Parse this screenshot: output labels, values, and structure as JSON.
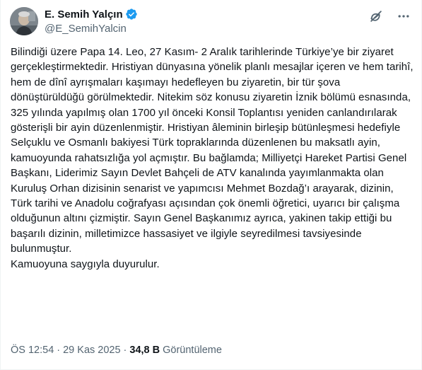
{
  "author": {
    "display_name": "E. Semih Yalçın",
    "handle": "@E_SemihYalcin",
    "verified_color": "#1d9bf0"
  },
  "header_actions": {
    "grok_icon": "grok-icon",
    "more_icon": "more-options-icon"
  },
  "tweet": {
    "text": "Bilindiği üzere Papa 14. Leo, 27 Kasım- 2 Aralık tarihlerinde Türkiye’ye bir ziyaret gerçekleştirmektedir. Hristiyan dünyasına yönelik planlı mesajlar içeren ve hem tarihî, hem de dînî ayrışmaları kaşımayı hedefleyen bu ziyaretin, bir tür şova dönüştürüldüğü görülmektedir. Nitekim söz konusu ziyaretin İznik bölümü esnasında, 325 yılında yapılmış olan 1700 yıl önceki Konsil Toplantısı yeniden canlandırılarak gösterişli bir ayin düzenlenmiştir. Hristiyan âleminin birleşip bütünleşmesi hedefiyle Selçuklu ve Osmanlı bakiyesi Türk topraklarında düzenlenen bu maksatlı ayin, kamuoyunda rahatsızlığa yol açmıştır. Bu bağlamda; Milliyetçi Hareket Partisi Genel Başkanı, Liderimiz Sayın Devlet Bahçeli de ATV kanalında yayımlanmakta olan Kuruluş Orhan dizisinin senarist ve yapımcısı Mehmet Bozdağ’ı arayarak, dizinin, Türk tarihi ve Anadolu coğrafyası açısından çok önemli öğretici, uyarıcı bir çalışma olduğunun altını çizmiştir. Sayın Genel Başkanımız ayrıca, yakinen takip ettiği bu başarılı dizinin, milletimizce hassasiyet ve ilgiyle seyredilmesi tavsiyesinde bulunmuştur.\nKamuoyuna saygıyla duyurulur.",
    "time": "ÖS 12:54",
    "separator": "·",
    "date": "29 Kas 2025",
    "views_count": "34,8 B",
    "views_label": "Görüntüleme"
  }
}
